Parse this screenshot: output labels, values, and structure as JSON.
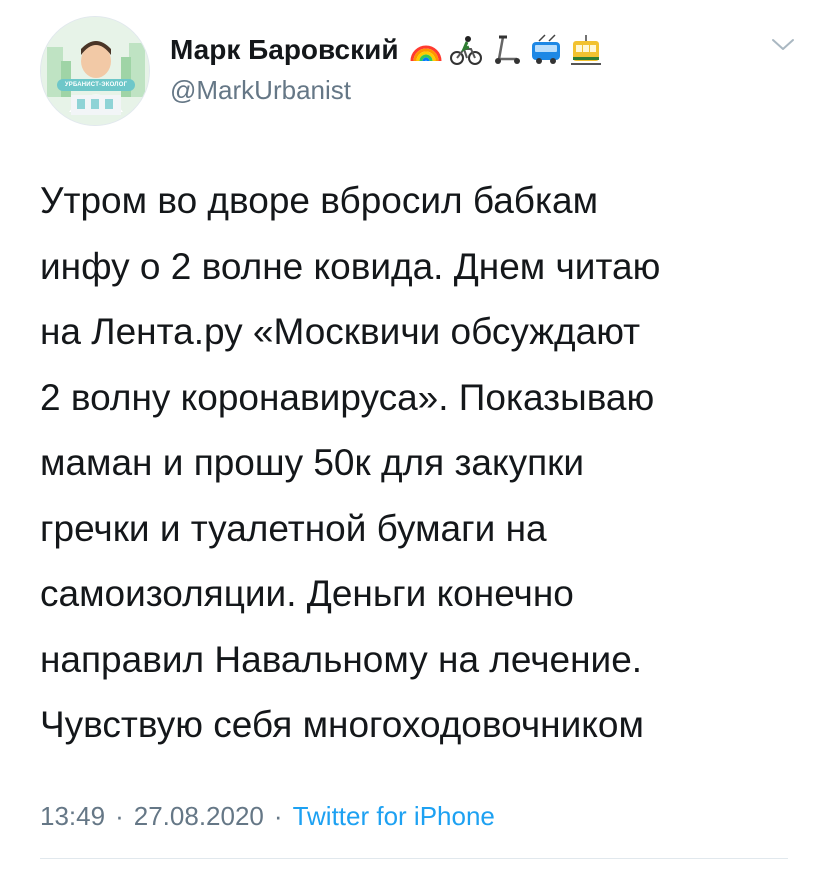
{
  "tweet": {
    "author": {
      "display_name": "Марк Баровский",
      "handle": "@MarkUrbanist",
      "avatar_badge": "УРБАНИСТ-ЭКОЛОГ",
      "name_emojis": [
        "rainbow-icon",
        "bicycle-rider-icon",
        "kick-scooter-icon",
        "trolleybus-icon",
        "tram-icon"
      ]
    },
    "text": "Утром во дворе вбросил бабкам\nинфу о 2 волне ковида. Днем читаю\nна Лента.ру «Москвичи обсуждают\n2 волну коронавируса». Показываю\nмаман и прошу 50к для закупки\nгречки и туалетной бумаги на\nсамоизоляции. Деньги конечно\nнаправил Навальному на лечение.\nЧувствую себя многоходовочником",
    "time": "13:49",
    "separator": "·",
    "date": "27.08.2020",
    "source": "Twitter for iPhone"
  },
  "colors": {
    "primary_text": "#14171a",
    "secondary_text": "#657786",
    "link": "#1da1f2",
    "divider": "#e1e8ed"
  }
}
